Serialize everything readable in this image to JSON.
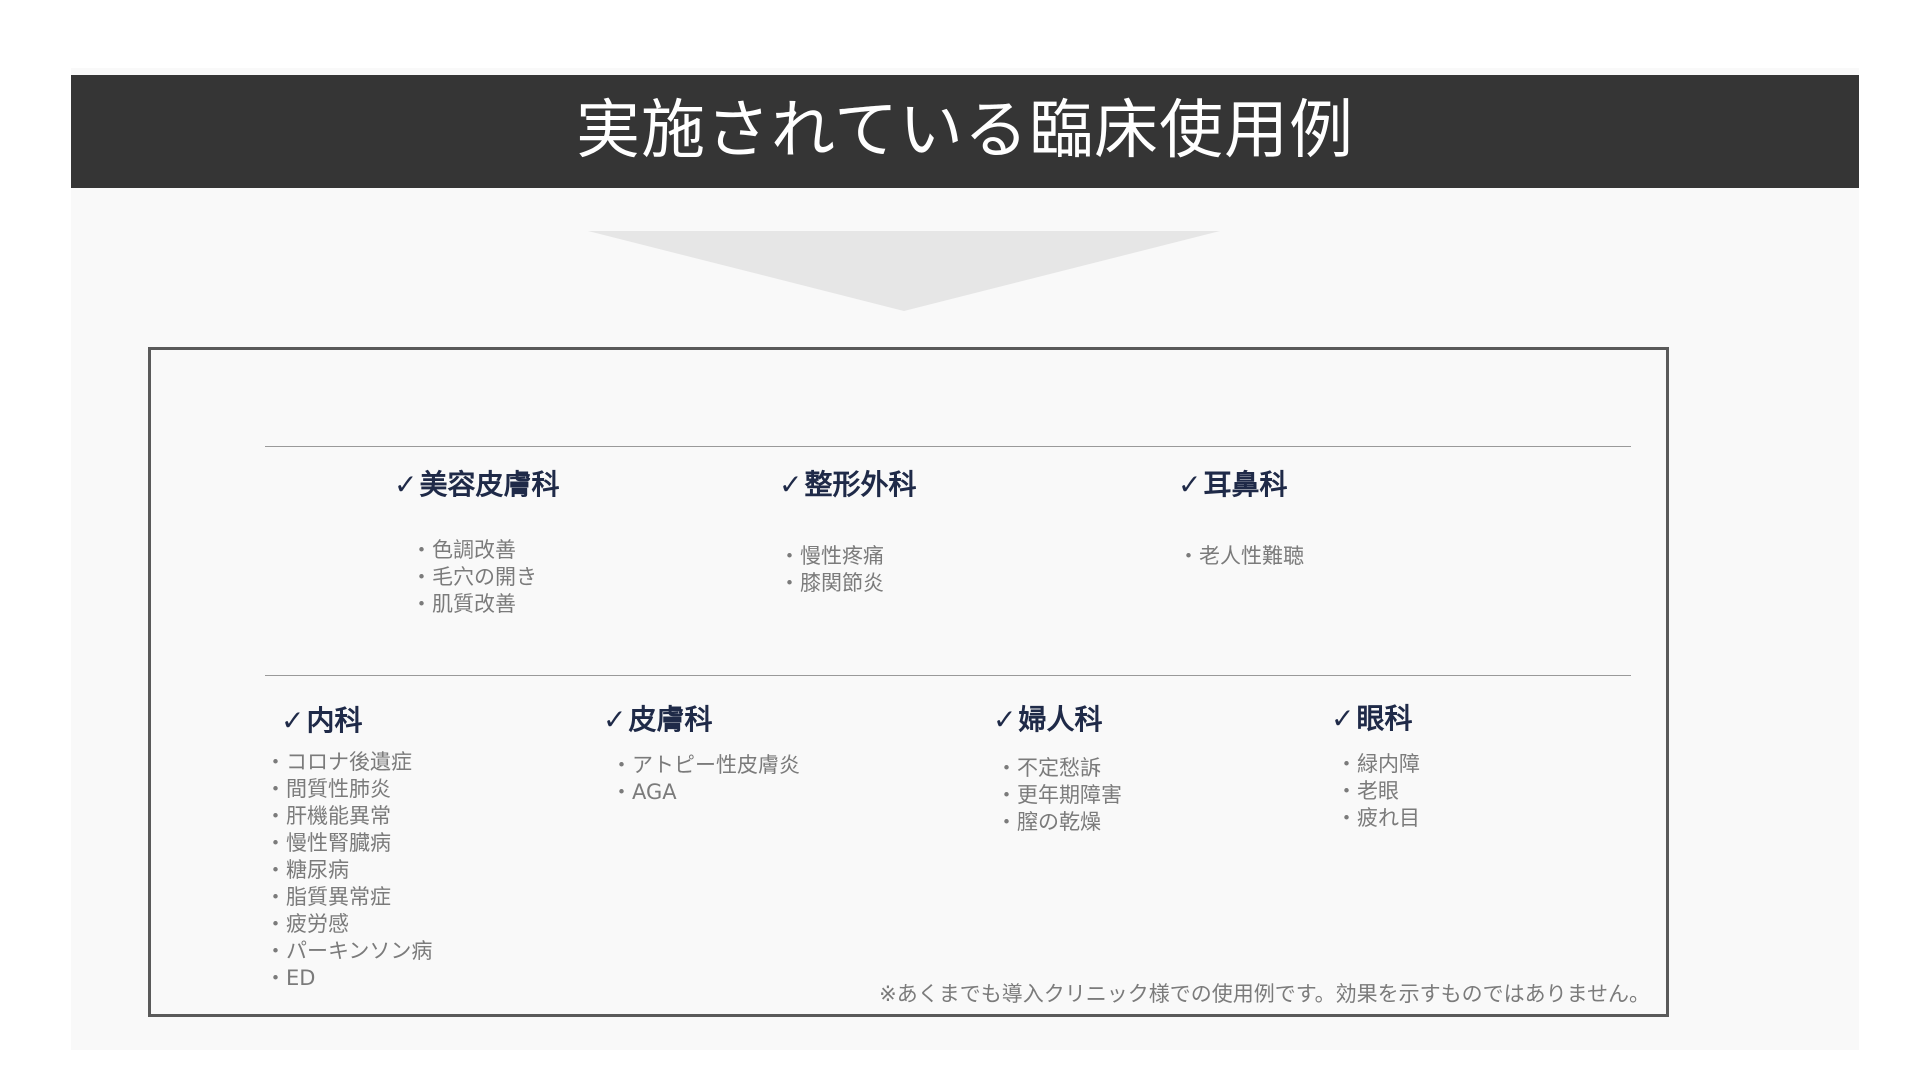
{
  "title": "実施されている臨床使用例",
  "row1": [
    {
      "check": "✓",
      "name": "美容皮膚科",
      "items": [
        "・色調改善",
        "・毛穴の開き",
        "・肌質改善"
      ]
    },
    {
      "check": "✓",
      "name": "整形外科",
      "items": [
        "・慢性疼痛",
        "・膝関節炎"
      ]
    },
    {
      "check": "✓",
      "name": "耳鼻科",
      "items": [
        "・老人性難聴"
      ]
    }
  ],
  "row2": [
    {
      "check": "✓",
      "name": "内科",
      "items": [
        "・コロナ後遺症",
        "・間質性肺炎",
        "・肝機能異常",
        "・慢性腎臓病",
        "・糖尿病",
        "・脂質異常症",
        "・疲労感",
        "・パーキンソン病",
        "・ED"
      ]
    },
    {
      "check": "✓",
      "name": "皮膚科",
      "items": [
        "・アトピー性皮膚炎",
        "・AGA"
      ]
    },
    {
      "check": "✓",
      "name": "婦人科",
      "items": [
        "・不定愁訴",
        "・更年期障害",
        "・膣の乾燥"
      ]
    },
    {
      "check": "✓",
      "name": "眼科",
      "items": [
        "・緑内障",
        "・老眼",
        "・疲れ目"
      ]
    }
  ],
  "note": "※あくまでも導入クリニック様での使用例です。効果を示すものではありません。",
  "colors": {
    "title_bar": "#353535",
    "heading": "#1f2a48",
    "item_text": "#7b7b7b",
    "arrow": "#e6e6e6"
  }
}
